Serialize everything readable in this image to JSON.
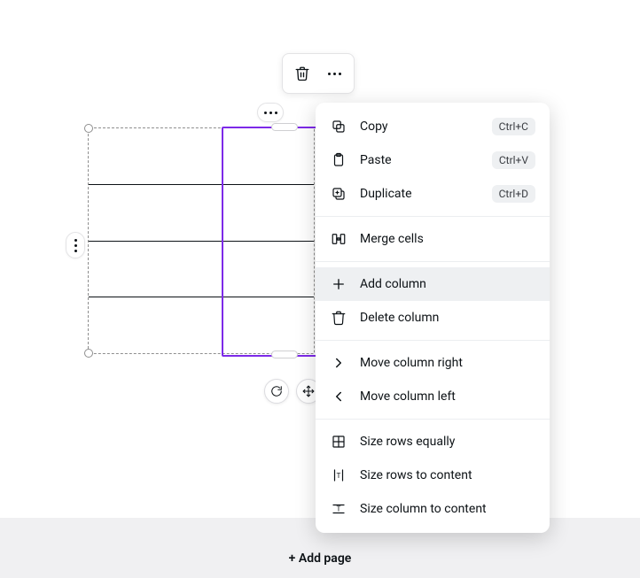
{
  "footer": {
    "add_page_label": "+ Add page"
  },
  "selection": {
    "rows": 4,
    "columns": 2,
    "selected_column_index": 1
  },
  "menu": {
    "copy": {
      "label": "Copy",
      "shortcut": "Ctrl+C"
    },
    "paste": {
      "label": "Paste",
      "shortcut": "Ctrl+V"
    },
    "duplicate": {
      "label": "Duplicate",
      "shortcut": "Ctrl+D"
    },
    "merge": {
      "label": "Merge cells"
    },
    "add_column": {
      "label": "Add column"
    },
    "delete_column": {
      "label": "Delete column"
    },
    "move_right": {
      "label": "Move column right"
    },
    "move_left": {
      "label": "Move column left"
    },
    "size_rows_eq": {
      "label": "Size rows equally"
    },
    "size_rows_content": {
      "label": "Size rows to content"
    },
    "size_col_content": {
      "label": "Size column to content"
    }
  }
}
